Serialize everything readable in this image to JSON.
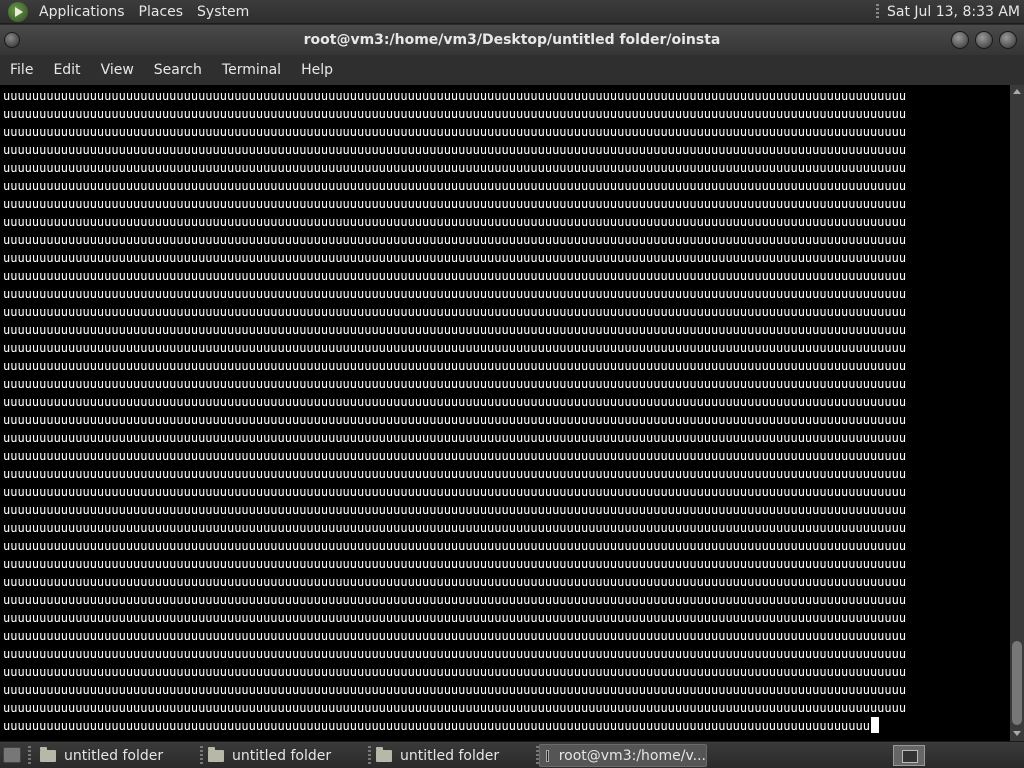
{
  "top_panel": {
    "menus": [
      "Applications",
      "Places",
      "System"
    ],
    "clock": "Sat Jul 13,  8:33 AM"
  },
  "window": {
    "title": "root@vm3:/home/vm3/Desktop/untitled folder/oinsta"
  },
  "menubar": {
    "items": [
      "File",
      "Edit",
      "View",
      "Search",
      "Terminal",
      "Help"
    ]
  },
  "terminal": {
    "repeat_char": "u",
    "full_line_count": 35,
    "chars_per_line": 125,
    "last_line_chars": 120
  },
  "taskbar": {
    "tasks": [
      {
        "label": "untitled folder",
        "icon": "folder-icon"
      },
      {
        "label": "untitled folder",
        "icon": "folder-icon"
      },
      {
        "label": "untitled folder",
        "icon": "folder-icon"
      },
      {
        "label": "root@vm3:/home/v...",
        "icon": "terminal-icon",
        "active": true
      }
    ]
  }
}
